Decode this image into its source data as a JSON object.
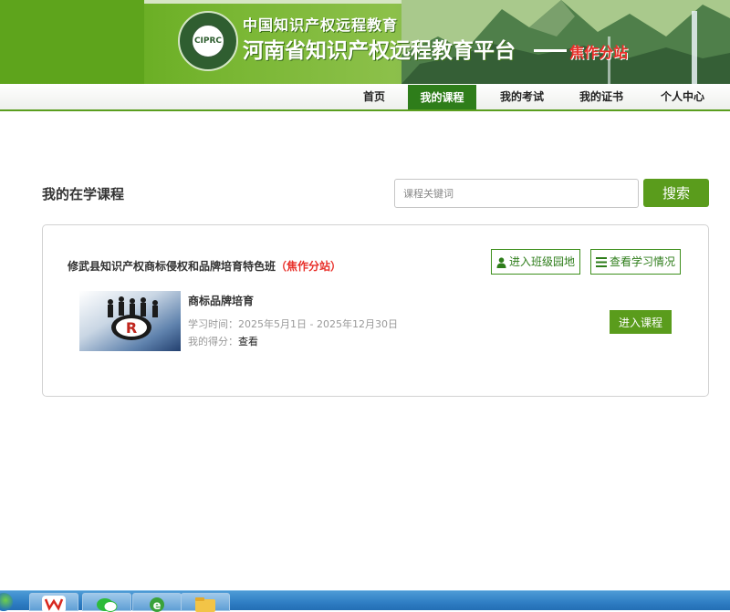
{
  "header": {
    "subtitle": "中国知识产权远程教育",
    "title": "河南省知识产权远程教育平台",
    "branch_suffix": "焦作分站",
    "logo_text": "CIPRC"
  },
  "nav": {
    "items": [
      {
        "label": "首页",
        "active": false
      },
      {
        "label": "我的课程",
        "active": true
      },
      {
        "label": "我的考试",
        "active": false
      },
      {
        "label": "我的证书",
        "active": false
      },
      {
        "label": "个人中心",
        "active": false
      }
    ]
  },
  "main": {
    "title": "我的在学课程",
    "search": {
      "placeholder": "课程关键词",
      "value": "",
      "button_label": "搜索"
    },
    "class": {
      "name": "修武县知识产权商标侵权和品牌培育特色班",
      "branch": "（焦作分站）",
      "enter_class_label": "进入班级园地",
      "view_progress_label": "查看学习情况"
    },
    "course": {
      "name": "商标品牌培育",
      "study_time_label": "学习时间：",
      "study_time_value": "2025年5月1日 - 2025年12月30日",
      "score_label": "我的得分：",
      "score_link": "查看",
      "enter_label": "进入课程"
    }
  },
  "colors": {
    "brand_green": "#5a9c1c",
    "nav_active": "#2e7d1a",
    "branch_red": "#e8302a"
  },
  "icons": [
    "user-icon",
    "list-icon",
    "registered-trademark-icon"
  ],
  "taskbar": {
    "apps": [
      "wps-icon",
      "wechat-icon",
      "ie-browser-icon",
      "file-explorer-icon"
    ]
  }
}
